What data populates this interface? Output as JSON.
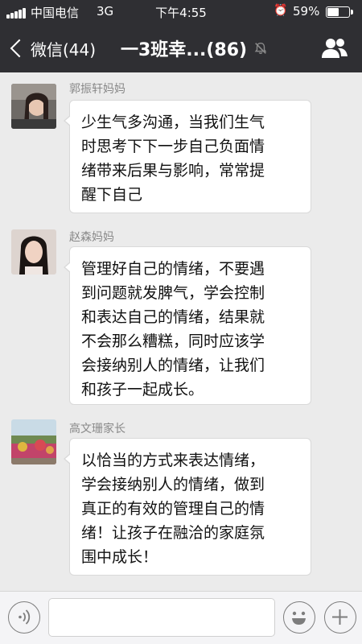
{
  "status_bar": {
    "carrier": "中国电信",
    "network": "3G",
    "time": "下午4:55",
    "battery_percent": "59%",
    "battery_level": 0.59
  },
  "nav": {
    "back_label": "微信(44)",
    "chat_title": "一3班幸...(86)",
    "icons": [
      "chevron-left-icon",
      "mute-bell-icon",
      "group-members-icon"
    ]
  },
  "messages": [
    {
      "sender": "郭振轩妈妈",
      "lines": [
        "少生气多沟通，当我们生气",
        "时思考下下一步自己负面情",
        "绪带来后果与影响，常常提",
        "醒下自己"
      ]
    },
    {
      "sender": "赵森妈妈",
      "lines": [
        "管理好自己的情绪，不要遇",
        "到问题就发脾气，学会控制",
        "和表达自己的情绪，结果就",
        "不会那么糟糕，同时应该学",
        "会接纳别人的情绪，让我们",
        "和孩子一起成长。"
      ]
    },
    {
      "sender": "高文珊家长",
      "lines": [
        "以恰当的方式来表达情绪，",
        "学会接纳别人的情绪，做到",
        "真正的有效的管理自己的情",
        "绪！让孩子在融洽的家庭氛",
        "围中成长！"
      ]
    }
  ],
  "input_bar": {
    "icons": [
      "voice-icon",
      "emoji-icon",
      "plus-icon"
    ],
    "input_value": ""
  }
}
